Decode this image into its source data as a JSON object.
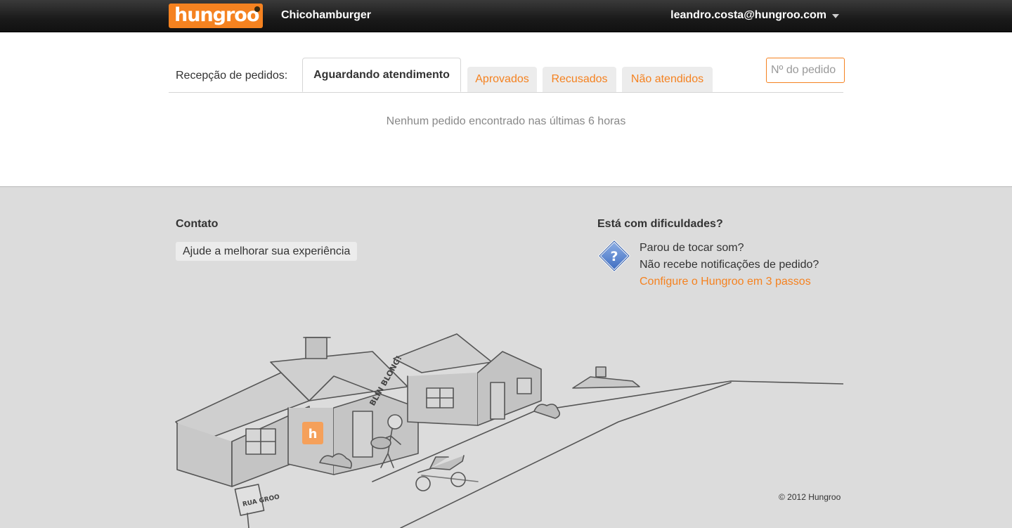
{
  "header": {
    "logo_text": "hungroo",
    "store_name": "Chicohamburger",
    "user_email": "leandro.costa@hungroo.com"
  },
  "orders": {
    "section_label": "Recepção de pedidos:",
    "tabs": [
      {
        "label": "Aguardando atendimento",
        "active": true
      },
      {
        "label": "Aprovados",
        "active": false
      },
      {
        "label": "Recusados",
        "active": false
      },
      {
        "label": "Não atendidos",
        "active": false
      }
    ],
    "search_placeholder": "Nº do pedido",
    "empty_message": "Nenhum pedido encontrado nas últimas 6 horas"
  },
  "footer": {
    "contact_title": "Contato",
    "feedback_button": "Ajude a melhorar sua experiência",
    "help_title": "Está com dificuldades?",
    "help_lines": [
      "Parou de tocar som?",
      "Não recebe notificações de pedido?"
    ],
    "help_link": "Configure o Hungroo em 3 passos",
    "copyright": "© 2012 Hungroo",
    "illustration": {
      "speech_text": "BLIN BLONG!",
      "sign_text": "RUA GROO",
      "badge_letter": "h"
    }
  },
  "colors": {
    "accent": "#f58220",
    "topbar": "#1a1a1a",
    "footer_bg": "#dcdcdc"
  }
}
